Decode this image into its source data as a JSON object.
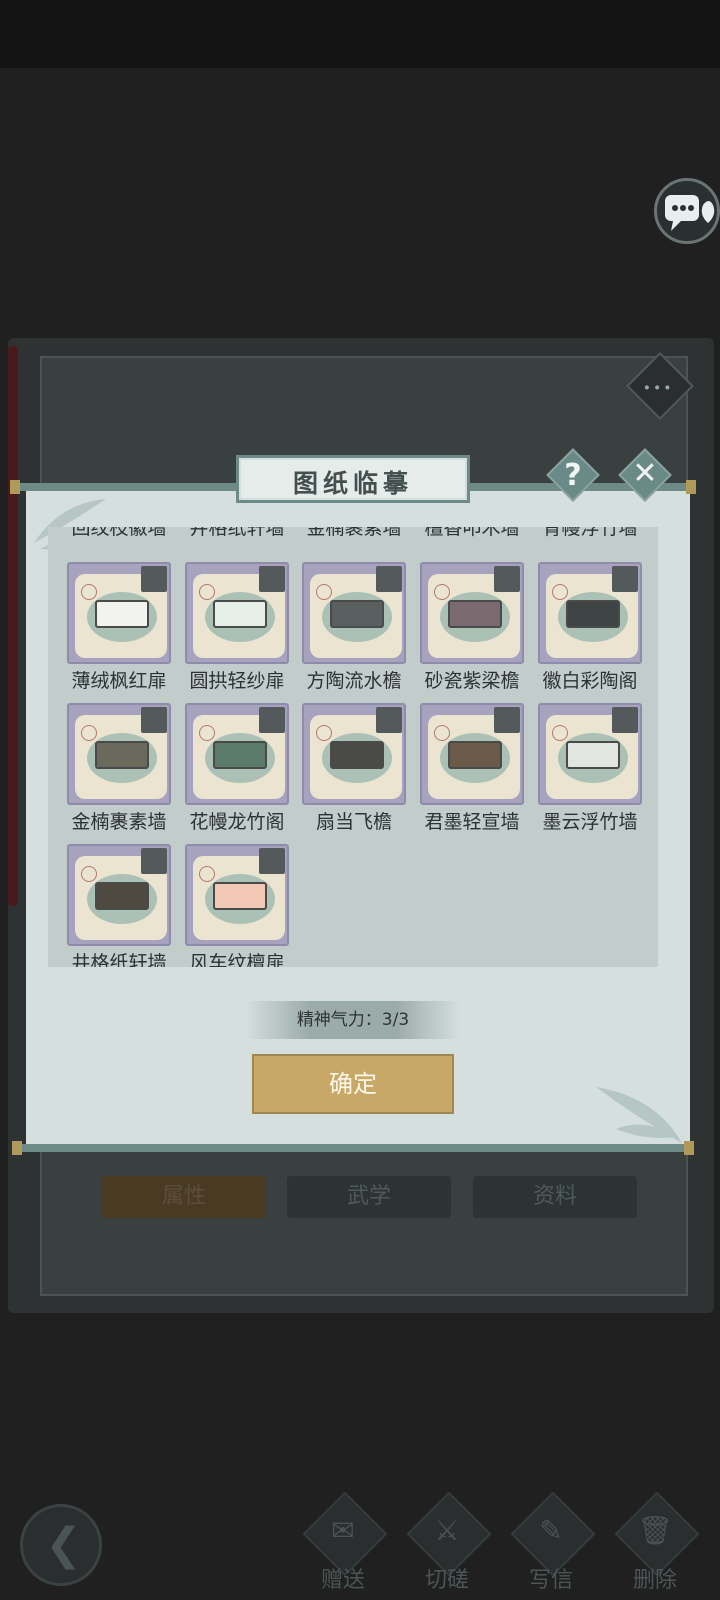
{
  "dialog": {
    "title": "图纸临摹",
    "help_label": "?",
    "close_label": "✕",
    "stamina_text": "精神气力：3/3",
    "confirm_label": "确定"
  },
  "partial_row": [
    "回纹枝徽墙",
    "井格纸轩墙",
    "金楠裹素墙",
    "檀香叩木墙",
    "青幔浮竹墙"
  ],
  "blueprints": [
    {
      "name": "薄绒枫红扉",
      "color": "#f2f2ee"
    },
    {
      "name": "圆拱轻纱扉",
      "color": "#e6efe8"
    },
    {
      "name": "方陶流水檐",
      "color": "#5a6060"
    },
    {
      "name": "砂瓷紫梁檐",
      "color": "#7a6a70"
    },
    {
      "name": "徽白彩陶阁",
      "color": "#3e4444"
    },
    {
      "name": "金楠裹素墙",
      "color": "#6a6a5c"
    },
    {
      "name": "花幔龙竹阁",
      "color": "#5a7a6a"
    },
    {
      "name": "扇当飞檐",
      "color": "#4a4a46"
    },
    {
      "name": "君墨轻宣墙",
      "color": "#6a5a48"
    },
    {
      "name": "墨云浮竹墙",
      "color": "#e2e6e0"
    },
    {
      "name": "井格纸轩墙",
      "color": "#4e4a42"
    },
    {
      "name": "风车纹檀扉",
      "color": "#f0c8b4"
    }
  ],
  "background_tabs": [
    "属性",
    "武学",
    "资料"
  ],
  "bottom_actions": [
    {
      "label": "赠送",
      "icon": "scroll-icon"
    },
    {
      "label": "切磋",
      "icon": "sword-icon"
    },
    {
      "label": "写信",
      "icon": "letter-icon"
    },
    {
      "label": "删除",
      "icon": "trash-icon"
    }
  ]
}
